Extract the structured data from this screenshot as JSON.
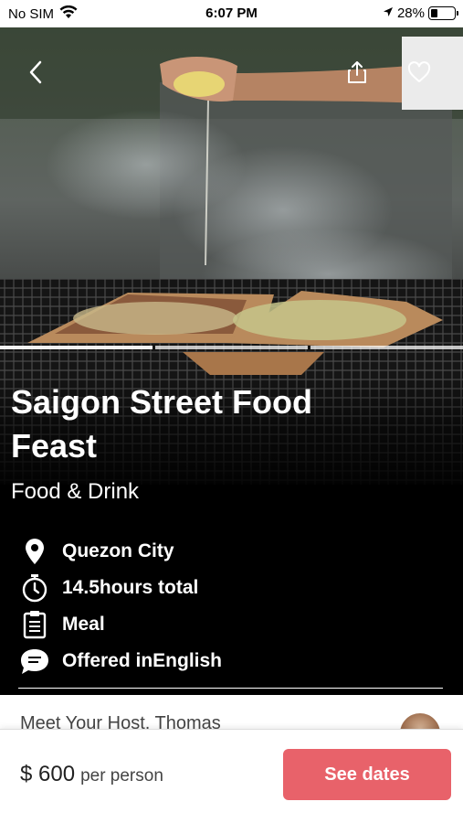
{
  "status_bar": {
    "carrier": "No SIM",
    "time": "6:07 PM",
    "battery": "28%",
    "battery_level": 0.28
  },
  "nav": {
    "back_icon": "chevron-left-icon",
    "share_icon": "share-icon",
    "favorite_icon": "heart-icon"
  },
  "gallery": {
    "segments": 3,
    "active": 0
  },
  "experience": {
    "title": "Saigon Street Food Feast",
    "category": "Food & Drink",
    "details": [
      {
        "icon": "location-pin-icon",
        "text": "Quezon City"
      },
      {
        "icon": "stopwatch-icon",
        "text": "14.5hours total"
      },
      {
        "icon": "clipboard-icon",
        "text": "Meal"
      },
      {
        "icon": "speech-bubble-icon",
        "text": "Offered inEnglish"
      }
    ]
  },
  "host": {
    "label": "Meet Your Host, Thomas"
  },
  "footer": {
    "price": "$ 600",
    "price_unit": "per person",
    "cta": "See dates",
    "cta_color": "#e8626a"
  }
}
